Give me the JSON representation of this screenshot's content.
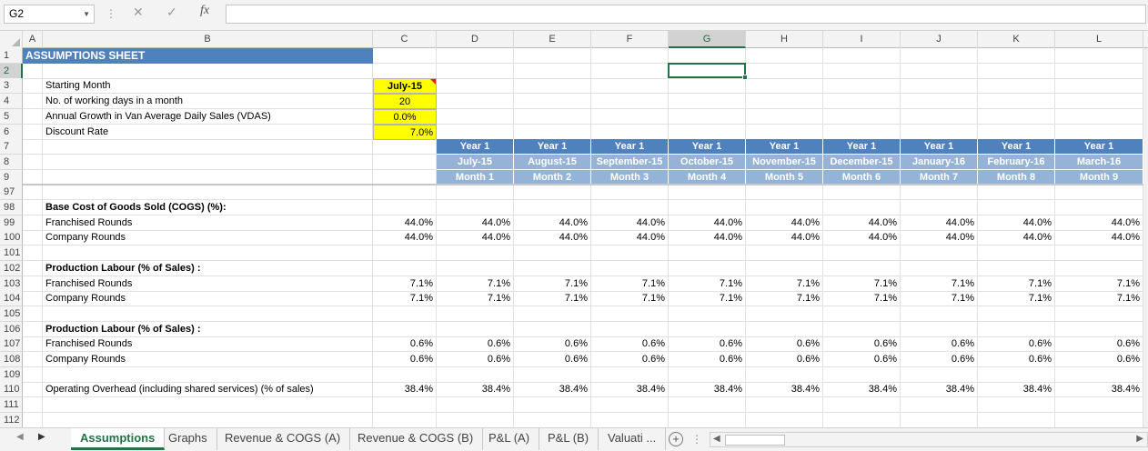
{
  "formula_bar": {
    "name_box": "G2",
    "formula": "",
    "fx_label": "fx"
  },
  "columns": [
    "A",
    "B",
    "C",
    "D",
    "E",
    "F",
    "G",
    "H",
    "I",
    "J",
    "K",
    "L"
  ],
  "selected_column": "G",
  "selected_row": "2",
  "sheet": {
    "title": "ASSUMPTIONS SHEET",
    "inputs": [
      {
        "label": "Starting Month",
        "value": "July-15"
      },
      {
        "label": "No. of working days in a month",
        "value": "20"
      },
      {
        "label": "Annual Growth in Van Average Daily Sales  (VDAS)",
        "value": "0.0%"
      },
      {
        "label": "Discount Rate",
        "value": "7.0%"
      }
    ],
    "period_headers": {
      "years": [
        "Year 1",
        "Year 1",
        "Year 1",
        "Year 1",
        "Year 1",
        "Year 1",
        "Year 1",
        "Year 1",
        "Year 1"
      ],
      "months": [
        "July-15",
        "August-15",
        "September-15",
        "October-15",
        "November-15",
        "December-15",
        "January-16",
        "February-16",
        "March-16"
      ],
      "month_numbers": [
        "Month 1",
        "Month 2",
        "Month 3",
        "Month 4",
        "Month 5",
        "Month 6",
        "Month 7",
        "Month 8",
        "Month 9"
      ]
    },
    "row_numbers": [
      "1",
      "2",
      "3",
      "4",
      "5",
      "6",
      "7",
      "8",
      "9",
      "97",
      "98",
      "99",
      "100",
      "101",
      "102",
      "103",
      "104",
      "105",
      "106",
      "107",
      "108",
      "109",
      "110",
      "111",
      "112"
    ],
    "sections": [
      {
        "row": "98",
        "label": "Base Cost of Goods Sold (COGS) (%):",
        "bold": true,
        "values": []
      },
      {
        "row": "99",
        "label": "Franchised Rounds",
        "values": [
          "44.0%",
          "44.0%",
          "44.0%",
          "44.0%",
          "44.0%",
          "44.0%",
          "44.0%",
          "44.0%",
          "44.0%",
          "44.0%"
        ]
      },
      {
        "row": "100",
        "label": "Company Rounds",
        "values": [
          "44.0%",
          "44.0%",
          "44.0%",
          "44.0%",
          "44.0%",
          "44.0%",
          "44.0%",
          "44.0%",
          "44.0%",
          "44.0%"
        ]
      },
      {
        "row": "101",
        "label": "",
        "values": []
      },
      {
        "row": "102",
        "label": "Production Labour (% of Sales) :",
        "bold": true,
        "values": []
      },
      {
        "row": "103",
        "label": "Franchised Rounds",
        "values": [
          "7.1%",
          "7.1%",
          "7.1%",
          "7.1%",
          "7.1%",
          "7.1%",
          "7.1%",
          "7.1%",
          "7.1%",
          "7.1%"
        ]
      },
      {
        "row": "104",
        "label": "Company Rounds",
        "values": [
          "7.1%",
          "7.1%",
          "7.1%",
          "7.1%",
          "7.1%",
          "7.1%",
          "7.1%",
          "7.1%",
          "7.1%",
          "7.1%"
        ]
      },
      {
        "row": "105",
        "label": "",
        "values": []
      },
      {
        "row": "106",
        "label": "Production Labour (% of Sales) :",
        "bold": true,
        "values": []
      },
      {
        "row": "107",
        "label": "Franchised Rounds",
        "values": [
          "0.6%",
          "0.6%",
          "0.6%",
          "0.6%",
          "0.6%",
          "0.6%",
          "0.6%",
          "0.6%",
          "0.6%",
          "0.6%"
        ]
      },
      {
        "row": "108",
        "label": "Company Rounds",
        "values": [
          "0.6%",
          "0.6%",
          "0.6%",
          "0.6%",
          "0.6%",
          "0.6%",
          "0.6%",
          "0.6%",
          "0.6%",
          "0.6%"
        ]
      },
      {
        "row": "109",
        "label": "",
        "values": []
      },
      {
        "row": "110",
        "label": "Operating Overhead (including shared services) (% of sales)",
        "values": [
          "38.4%",
          "38.4%",
          "38.4%",
          "38.4%",
          "38.4%",
          "38.4%",
          "38.4%",
          "38.4%",
          "38.4%",
          "38.4%"
        ]
      },
      {
        "row": "111",
        "label": "",
        "values": []
      },
      {
        "row": "112",
        "label": "",
        "values": []
      }
    ]
  },
  "tabs": [
    {
      "label": "Assumptions",
      "active": true
    },
    {
      "label": "Graphs"
    },
    {
      "label": "Revenue & COGS (A)"
    },
    {
      "label": "Revenue & COGS (B)"
    },
    {
      "label": "P&L (A)"
    },
    {
      "label": "P&L (B)"
    },
    {
      "label": "Valuati ..."
    }
  ],
  "colors": {
    "excel_green": "#217346",
    "header_blue": "#4f81bd",
    "header_light_blue": "#95b3d7",
    "input_yellow": "#ffff00"
  }
}
